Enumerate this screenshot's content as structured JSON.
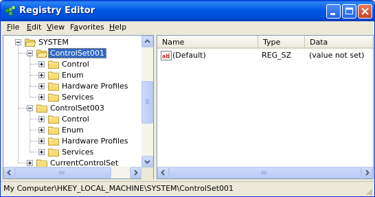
{
  "window": {
    "title": "Registry Editor"
  },
  "menu": [
    {
      "pre": "",
      "u": "F",
      "post": "ile"
    },
    {
      "pre": "",
      "u": "E",
      "post": "dit"
    },
    {
      "pre": "",
      "u": "V",
      "post": "iew"
    },
    {
      "pre": "F",
      "u": "a",
      "post": "vorites"
    },
    {
      "pre": "",
      "u": "H",
      "post": "elp"
    }
  ],
  "tree": {
    "items": [
      {
        "label": "SYSTEM",
        "level": 0,
        "expander": "minus",
        "open": true
      },
      {
        "label": "ControlSet001",
        "level": 1,
        "expander": "minus",
        "open": true,
        "selected": true
      },
      {
        "label": "Control",
        "level": 2,
        "expander": "plus"
      },
      {
        "label": "Enum",
        "level": 2,
        "expander": "plus"
      },
      {
        "label": "Hardware Profiles",
        "level": 2,
        "expander": "plus"
      },
      {
        "label": "Services",
        "level": 2,
        "expander": "plus"
      },
      {
        "label": "ControlSet003",
        "level": 1,
        "expander": "minus"
      },
      {
        "label": "Control",
        "level": 2,
        "expander": "plus"
      },
      {
        "label": "Enum",
        "level": 2,
        "expander": "plus"
      },
      {
        "label": "Hardware Profiles",
        "level": 2,
        "expander": "plus"
      },
      {
        "label": "Services",
        "level": 2,
        "expander": "plus"
      },
      {
        "label": "CurrentControlSet",
        "level": 1,
        "expander": "plus"
      }
    ]
  },
  "list": {
    "columns": {
      "name": "Name",
      "type": "Type",
      "data": "Data"
    },
    "rows": [
      {
        "name": "(Default)",
        "type": "REG_SZ",
        "data": "(value not set)",
        "icon": "string-value-icon"
      }
    ]
  },
  "status": {
    "path": "My Computer\\HKEY_LOCAL_MACHINE\\SYSTEM\\ControlSet001"
  },
  "colors": {
    "titlebar": "#0058e6",
    "selection": "#316ac5",
    "close": "#c8451d"
  }
}
